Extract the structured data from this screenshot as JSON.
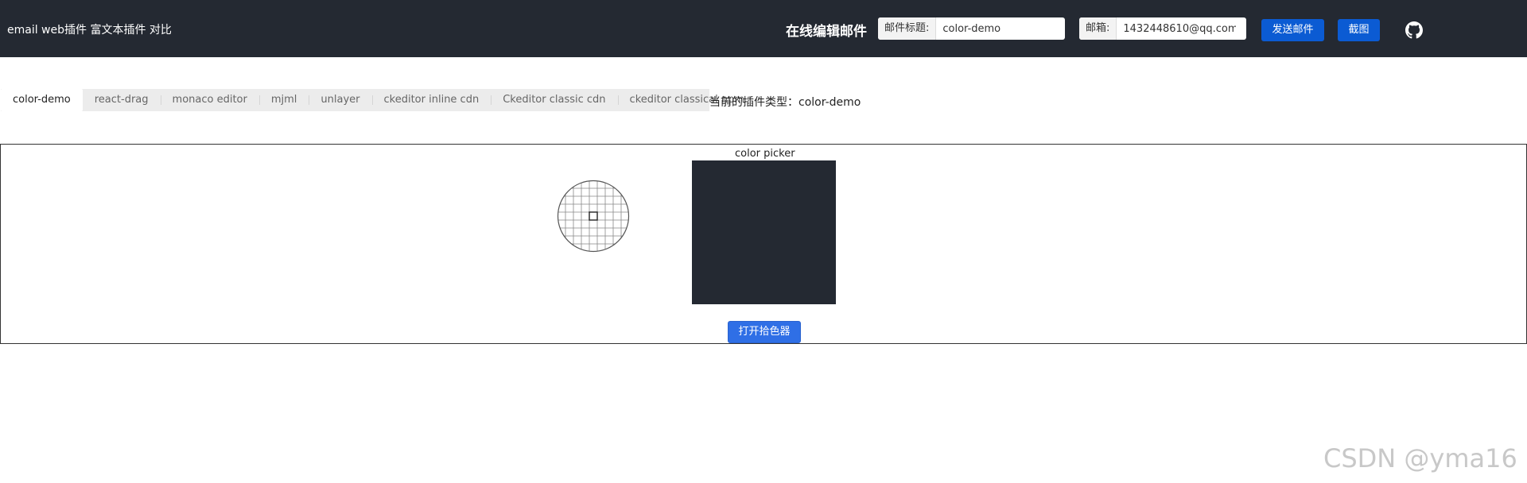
{
  "header": {
    "brand": "email web插件 富文本插件 对比",
    "title": "在线编辑邮件",
    "subject_label": "邮件标题:",
    "subject_value": "color-demo",
    "email_label": "邮箱:",
    "email_value": "1432448610@qq.com",
    "send_label": "发送邮件",
    "screenshot_label": "截图",
    "github_icon": "github-icon"
  },
  "tabs": [
    {
      "label": "color-demo",
      "active": true
    },
    {
      "label": "react-drag",
      "active": false
    },
    {
      "label": "monaco editor",
      "active": false
    },
    {
      "label": "mjml",
      "active": false
    },
    {
      "label": "unlayer",
      "active": false
    },
    {
      "label": "ckeditor inline cdn",
      "active": false
    },
    {
      "label": "Ckeditor classic cdn",
      "active": false
    },
    {
      "label": "ckeditor classical npm",
      "active": false
    }
  ],
  "plugin_type": "当前的插件类型：color-demo",
  "picker": {
    "title": "color picker",
    "current_color": "#242932",
    "open_button": "打开拾色器"
  },
  "colors": {
    "header_bg": "#242932",
    "primary_button": "#0b5bd3",
    "open_button": "#2f6fe6"
  },
  "watermark": "CSDN @yma16"
}
